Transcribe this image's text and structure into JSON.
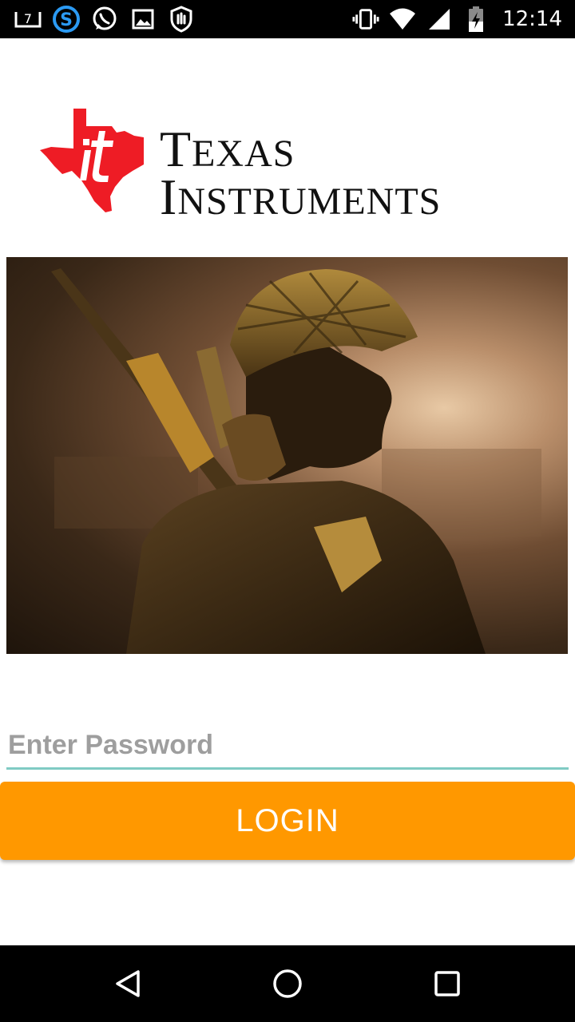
{
  "status_bar": {
    "time": "12:14",
    "notification_badge": "7",
    "left_icons": [
      "screen-icon",
      "skype-icon",
      "whatsapp-icon",
      "gallery-icon",
      "shield-hand-icon"
    ],
    "right_icons": [
      "vibrate-icon",
      "wifi-icon",
      "cell-signal-icon",
      "battery-charging-icon"
    ]
  },
  "logo": {
    "brand_line1_first": "T",
    "brand_line1_rest": "EXAS",
    "brand_line2_first": "I",
    "brand_line2_rest": "NSTRUMENTS",
    "brand_color": "#ee1c25"
  },
  "form": {
    "password_placeholder": "Enter Password",
    "password_value": "",
    "login_label": "LOGIN",
    "accent_color": "#80cbc4",
    "button_color": "#ff9800"
  },
  "nav_bar": {
    "icons": [
      "back-icon",
      "home-icon",
      "recents-icon"
    ]
  }
}
